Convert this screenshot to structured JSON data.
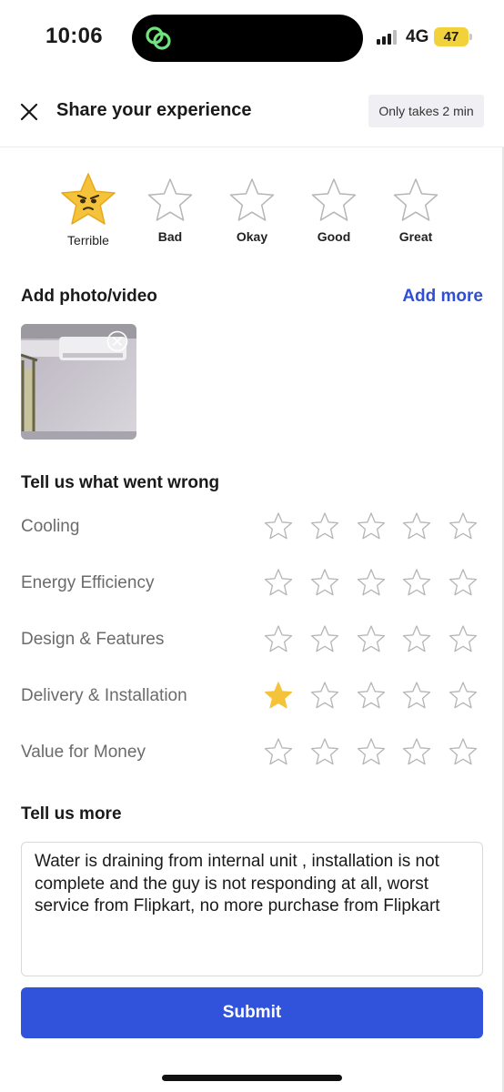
{
  "status_bar": {
    "time": "10:06",
    "network": "4G",
    "battery": "47"
  },
  "header": {
    "title": "Share your experience",
    "duration_badge": "Only takes 2 min"
  },
  "overall_rating": {
    "options": [
      "Terrible",
      "Bad",
      "Okay",
      "Good",
      "Great"
    ],
    "selected": "Terrible"
  },
  "media": {
    "title": "Add photo/video",
    "add_more": "Add more",
    "photo_count": 1
  },
  "aspects": {
    "title": "Tell us what went wrong",
    "items": [
      {
        "label": "Cooling",
        "rating": 0
      },
      {
        "label": "Energy Efficiency",
        "rating": 0
      },
      {
        "label": "Design & Features",
        "rating": 0
      },
      {
        "label": "Delivery & Installation",
        "rating": 1
      },
      {
        "label": "Value for Money",
        "rating": 0
      }
    ],
    "max_rating": 5
  },
  "comment": {
    "title": "Tell us more",
    "value": "Water is draining from internal unit , installation is not complete and the guy is not responding at all, worst service from Flipkart, no more purchase from Flipkart"
  },
  "submit_label": "Submit",
  "colors": {
    "accent": "#3153dc",
    "star_fill": "#f4c339",
    "star_outline": "#b5b5b5",
    "battery": "#f2d23b"
  }
}
